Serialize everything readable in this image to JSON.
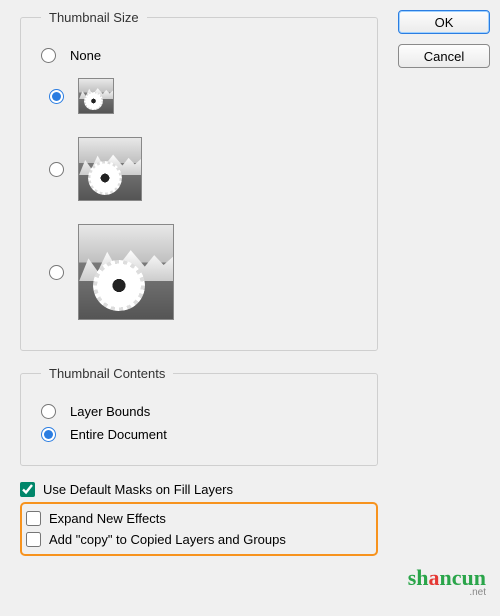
{
  "buttons": {
    "ok": "OK",
    "cancel": "Cancel"
  },
  "thumbnail_size": {
    "legend": "Thumbnail Size",
    "none_label": "None",
    "selected_index": 1
  },
  "thumbnail_contents": {
    "legend": "Thumbnail Contents",
    "layer_bounds": "Layer Bounds",
    "entire_document": "Entire Document",
    "selected": "entire_document"
  },
  "checkboxes": {
    "use_default_masks": {
      "label": "Use Default Masks on Fill Layers",
      "checked": true
    },
    "expand_new_effects": {
      "label": "Expand New Effects",
      "checked": false
    },
    "add_copy": {
      "label": "Add \"copy\" to Copied Layers and Groups",
      "checked": false
    }
  },
  "watermark": {
    "part1": "sh",
    "part2": "a",
    "part3": "ncun",
    "suffix": ".net"
  }
}
